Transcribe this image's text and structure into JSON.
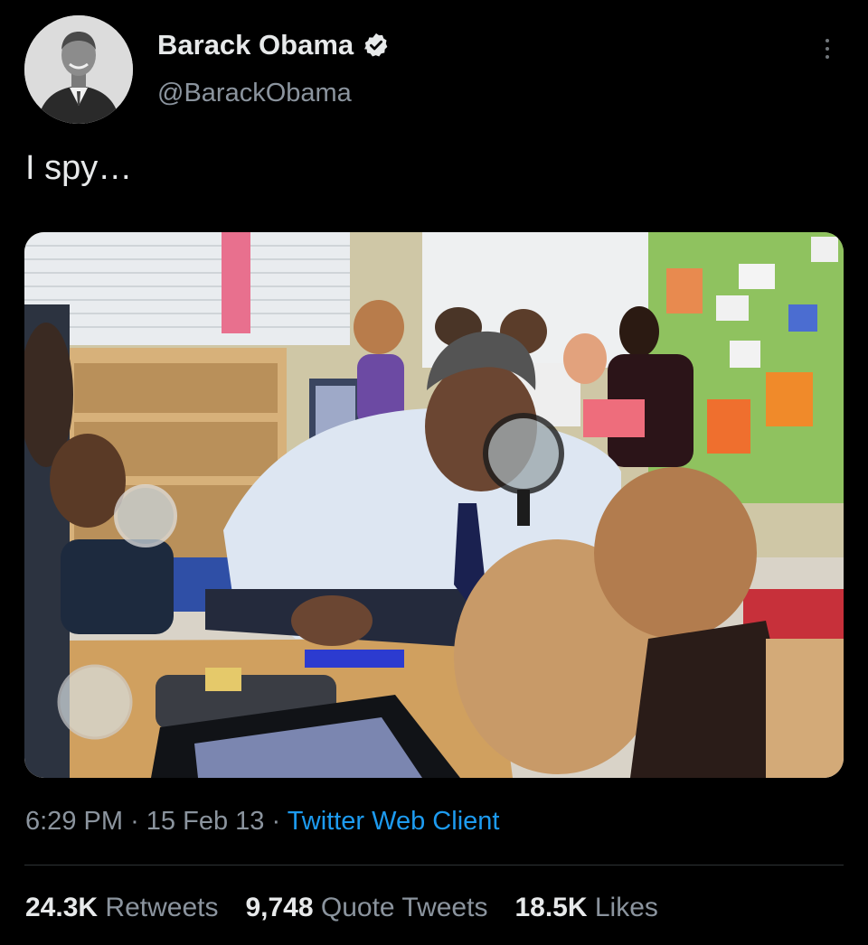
{
  "tweet": {
    "author": {
      "display_name": "Barack Obama",
      "handle": "@BarackObama",
      "verified": true,
      "avatar_icon": "profile-photo"
    },
    "text": "I spy…",
    "media": {
      "type": "photo",
      "icon": "photo"
    },
    "meta": {
      "time": "6:29 PM",
      "separator": "·",
      "date": "15 Feb 13",
      "source": "Twitter Web Client"
    },
    "stats": {
      "retweets": {
        "count": "24.3K",
        "label": "Retweets"
      },
      "quote_tweets": {
        "count": "9,748",
        "label": "Quote Tweets"
      },
      "likes": {
        "count": "18.5K",
        "label": "Likes"
      }
    }
  },
  "colors": {
    "background": "#000000",
    "primary_text": "#e7e9ea",
    "secondary_text": "#8b949e",
    "link": "#1d9bf0",
    "divider": "#2f3336"
  }
}
